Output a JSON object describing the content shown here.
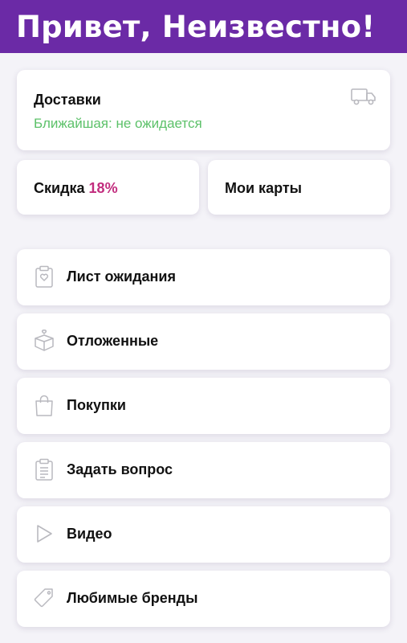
{
  "header": {
    "greeting": "Привет, Неизвестно!",
    "background_color": "#6b2aa6"
  },
  "delivery": {
    "title": "Доставки",
    "status": "Ближайшая: не ожидается",
    "status_color": "#5cc169",
    "icon": "truck-icon"
  },
  "discount": {
    "label": "Скидка",
    "value": "18%",
    "value_color": "#c22d7e"
  },
  "my_cards": {
    "label": "Мои карты"
  },
  "menu": {
    "items": [
      {
        "label": "Лист ожидания",
        "icon": "clipboard-heart-icon"
      },
      {
        "label": "Отложенные",
        "icon": "box-heart-icon"
      },
      {
        "label": "Покупки",
        "icon": "shopping-bag-icon"
      },
      {
        "label": "Задать вопрос",
        "icon": "clipboard-list-icon"
      },
      {
        "label": "Видео",
        "icon": "play-icon"
      },
      {
        "label": "Любимые бренды",
        "icon": "tag-icon"
      }
    ]
  }
}
